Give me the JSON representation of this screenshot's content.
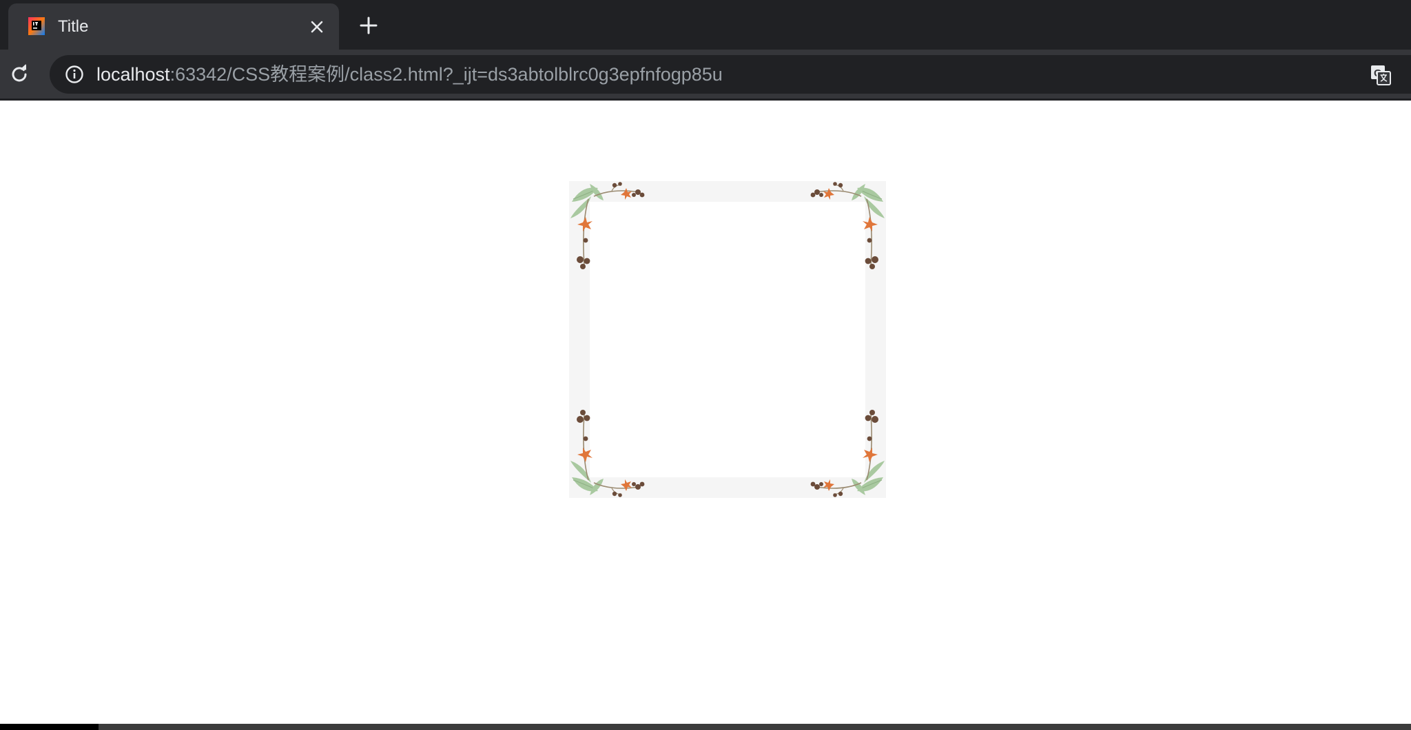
{
  "browser": {
    "tab": {
      "title": "Title",
      "favicon": "intellij-idea-icon"
    },
    "address_bar": {
      "host": "localhost",
      "rest": ":63342/CSS教程案例/class2.html?_ijt=ds3abtolblrc0g3epfnfogp85u"
    },
    "icons": {
      "close": "close-icon",
      "new_tab": "plus-icon",
      "reload": "reload-icon",
      "info": "info-icon",
      "translate": "translate-icon"
    }
  },
  "page": {
    "content": "decorative floral border frame",
    "colors": {
      "frame_background": "#f5f5f5",
      "leaf": "#a9c9a0",
      "flower": "#e0763a",
      "berry": "#6b4c3a",
      "stem": "#9a8a70"
    }
  },
  "status": {
    "load_progress": 0.07
  }
}
